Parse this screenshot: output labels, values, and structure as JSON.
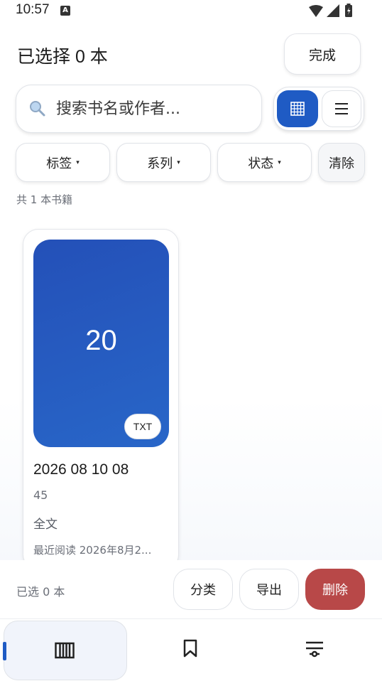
{
  "status_bar": {
    "time": "10:57",
    "notification_letter": "A"
  },
  "header": {
    "title": "已选择 0 本",
    "done_label": "完成"
  },
  "search": {
    "placeholder": "搜索书名或作者..."
  },
  "filters": {
    "tags_label": "标签",
    "series_label": "系列",
    "status_label": "状态",
    "clear_label": "清除",
    "caret": "▾"
  },
  "summary": {
    "count_text": "共 1 本书籍"
  },
  "books": [
    {
      "cover_text": "20",
      "format": "TXT",
      "title": "2026 08 10 08",
      "author": "45",
      "progress": "全文",
      "last_read": "最近阅读 2026年8月2..."
    }
  ],
  "action_bar": {
    "selected_text": "已选 0 本",
    "category_label": "分类",
    "export_label": "导出",
    "delete_label": "删除"
  },
  "nav": {
    "items": [
      {
        "icon": "library-icon",
        "active": true
      },
      {
        "icon": "bookmark-icon",
        "active": false
      },
      {
        "icon": "settings-sliders-icon",
        "active": false
      }
    ]
  },
  "colors": {
    "accent": "#1f5bc4",
    "danger": "#b84848",
    "cover_top": "#2450b8",
    "cover_bottom": "#2866c8"
  }
}
